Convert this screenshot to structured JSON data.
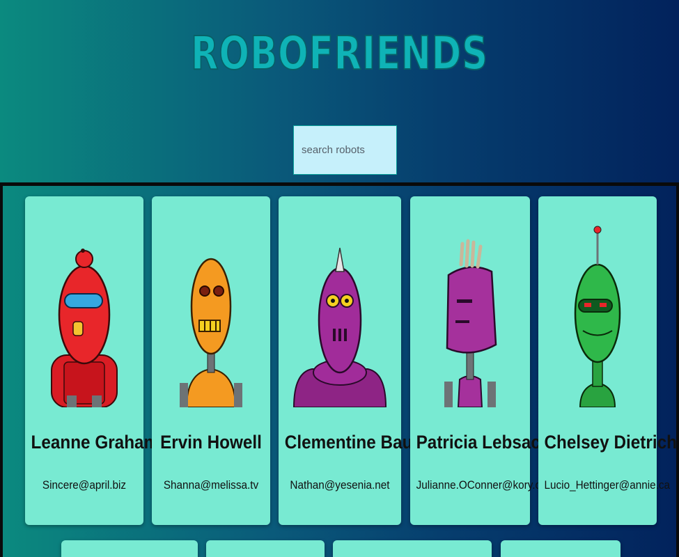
{
  "header": {
    "title": "ROBOFRIENDS",
    "search_placeholder": "search robots",
    "search_value": ""
  },
  "robots": [
    {
      "name": "Leanne Graham",
      "email": "Sincere@april.biz",
      "color": "#e8262a"
    },
    {
      "name": "Ervin Howell",
      "email": "Shanna@melissa.tv",
      "color": "#f49a21"
    },
    {
      "name": "Clementine Bauch",
      "email": "Nathan@yesenia.net",
      "color": "#a12c9a"
    },
    {
      "name": "Patricia Lebsack",
      "email": "Julianne.OConner@kory.org",
      "color": "#a5319c"
    },
    {
      "name": "Chelsey Dietrich",
      "email": "Lucio_Hettinger@annie.ca",
      "color": "#29a340"
    }
  ],
  "colors": {
    "card": "#78ead2",
    "search_bg": "#c6f0fb",
    "title": "#0fb3b6"
  }
}
